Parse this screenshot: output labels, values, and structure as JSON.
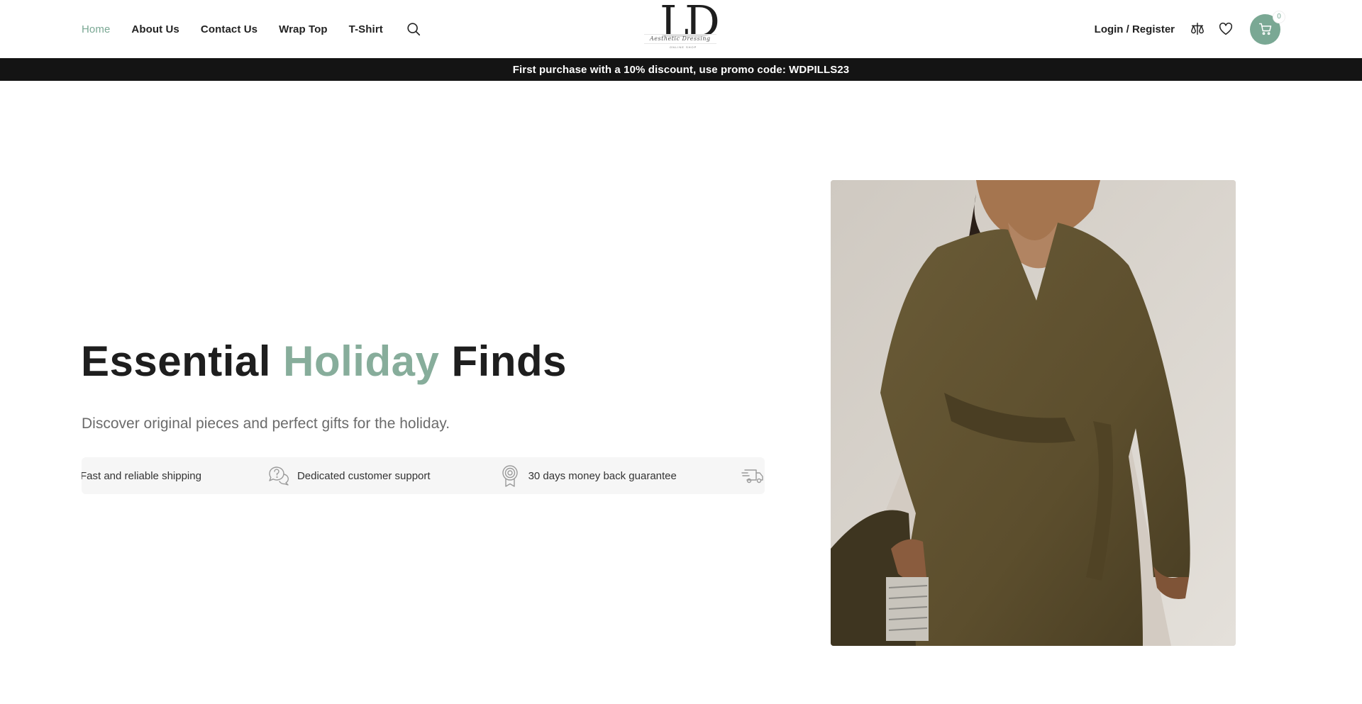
{
  "nav": {
    "items": [
      {
        "label": "Home",
        "active": true
      },
      {
        "label": "About Us"
      },
      {
        "label": "Contact Us"
      },
      {
        "label": "Wrap Top"
      },
      {
        "label": "T-Shirt"
      }
    ],
    "search_icon": "search-icon"
  },
  "logo": {
    "letters": "LD",
    "script": "Aesthetic Dressing",
    "tagline": "ONLINE SHOP"
  },
  "header_right": {
    "login_label": "Login / Register",
    "compare_icon": "compare-icon",
    "wishlist_icon": "heart-icon",
    "cart_icon": "cart-icon",
    "cart_count": "0"
  },
  "promo": {
    "text": "First purchase with a 10% discount, use promo code: WDPILLS23"
  },
  "hero": {
    "title_part1": "Essential",
    "title_accent": "Holiday",
    "title_part2": "Finds",
    "subtitle": "Discover original pieces and perfect gifts for the holiday."
  },
  "features": [
    {
      "label": "Fast and reliable shipping",
      "icon": "truck-icon"
    },
    {
      "label": "Dedicated customer support",
      "icon": "chat-question-icon"
    },
    {
      "label": "30 days money back guarantee",
      "icon": "award-badge-icon"
    },
    {
      "label": "",
      "icon": "truck-icon"
    }
  ],
  "colors": {
    "accent": "#7aa894",
    "promo_bg": "#141414",
    "features_bg": "#f6f6f6"
  }
}
